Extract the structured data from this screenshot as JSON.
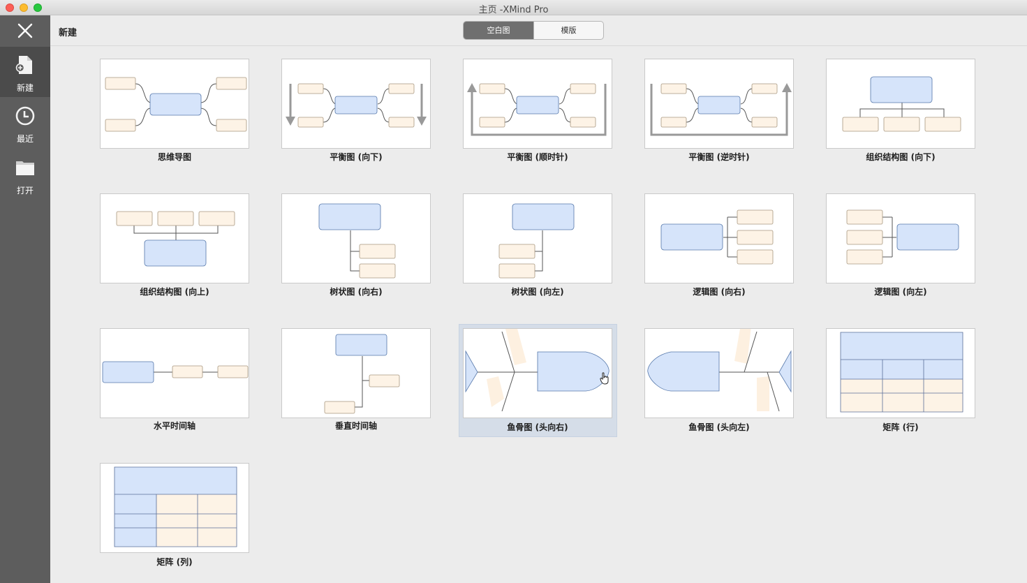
{
  "window": {
    "title": "主页 -XMind Pro"
  },
  "sidebar": {
    "close_icon": "close-icon",
    "items": [
      {
        "label": "新建",
        "icon": "new-file-icon",
        "active": true
      },
      {
        "label": "最近",
        "icon": "clock-icon",
        "active": false
      },
      {
        "label": "打开",
        "icon": "folder-icon",
        "active": false
      }
    ]
  },
  "toolbar": {
    "title": "新建",
    "tabs": [
      {
        "label": "空白图",
        "selected": true
      },
      {
        "label": "模版",
        "selected": false
      }
    ]
  },
  "templates": [
    {
      "label": "思维导图"
    },
    {
      "label": "平衡图 (向下)"
    },
    {
      "label": "平衡图 (顺时针)"
    },
    {
      "label": "平衡图 (逆时针)"
    },
    {
      "label": "组织结构图 (向下)"
    },
    {
      "label": "组织结构图 (向上)"
    },
    {
      "label": "树状图 (向右)"
    },
    {
      "label": "树状图 (向左)"
    },
    {
      "label": "逻辑图 (向右)"
    },
    {
      "label": "逻辑图 (向左)"
    },
    {
      "label": "水平时间轴"
    },
    {
      "label": "垂直时间轴"
    },
    {
      "label": "鱼骨图 (头向右)",
      "selected": true
    },
    {
      "label": "鱼骨图 (头向左)"
    },
    {
      "label": "矩阵 (行)"
    },
    {
      "label": "矩阵 (列)"
    }
  ],
  "colors": {
    "main_topic": "#d6e4fa",
    "sub_topic": "#fdf3e6",
    "sidebar_bg": "#5d5d5d",
    "selected_bg": "#d5dde8"
  }
}
